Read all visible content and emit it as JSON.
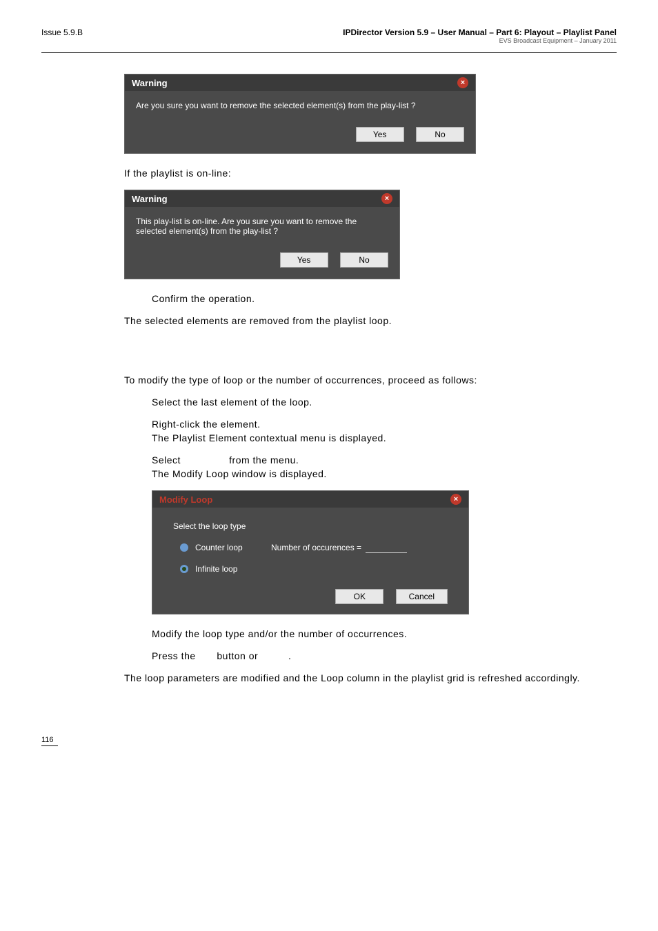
{
  "header": {
    "issue": "Issue 5.9.B",
    "title": "IPDirector Version 5.9 – User Manual – Part 6: Playout – Playlist Panel",
    "subtitle": "EVS Broadcast Equipment – January 2011"
  },
  "warn1": {
    "title": "Warning",
    "msg": "Are you sure you want to remove the selected element(s) from the play-list ?",
    "yes": "Yes",
    "no": "No"
  },
  "online_text": "If the playlist is on-line:",
  "warn2": {
    "title": "Warning",
    "msg": "This play-list is on-line. Are you sure you want to remove the selected element(s) from the play-list ?",
    "yes": "Yes",
    "no": "No"
  },
  "confirm": "Confirm the operation.",
  "removed": "The selected elements are removed from the playlist loop.",
  "modify_intro": "To modify the type of loop or the number of occurrences, proceed as follows:",
  "step1": "Select the last element of the loop.",
  "step2a": "Right-click the element.",
  "step2b": "The Playlist Element contextual menu is displayed.",
  "step3a_pre": "Select",
  "step3a_post": "from the menu.",
  "step3b": "The Modify Loop window is displayed.",
  "modify": {
    "title": "Modify Loop",
    "select": "Select the loop type",
    "counter": "Counter loop",
    "occ": "Number of occurences =",
    "infinite": "Infinite loop",
    "ok": "OK",
    "cancel": "Cancel"
  },
  "step4": "Modify the loop type and/or the number of occurrences.",
  "step5_pre": "Press the",
  "step5_mid": "button or",
  "step5_post": ".",
  "final": "The loop parameters are modified and the Loop column in the playlist grid is refreshed accordingly.",
  "page": "116"
}
